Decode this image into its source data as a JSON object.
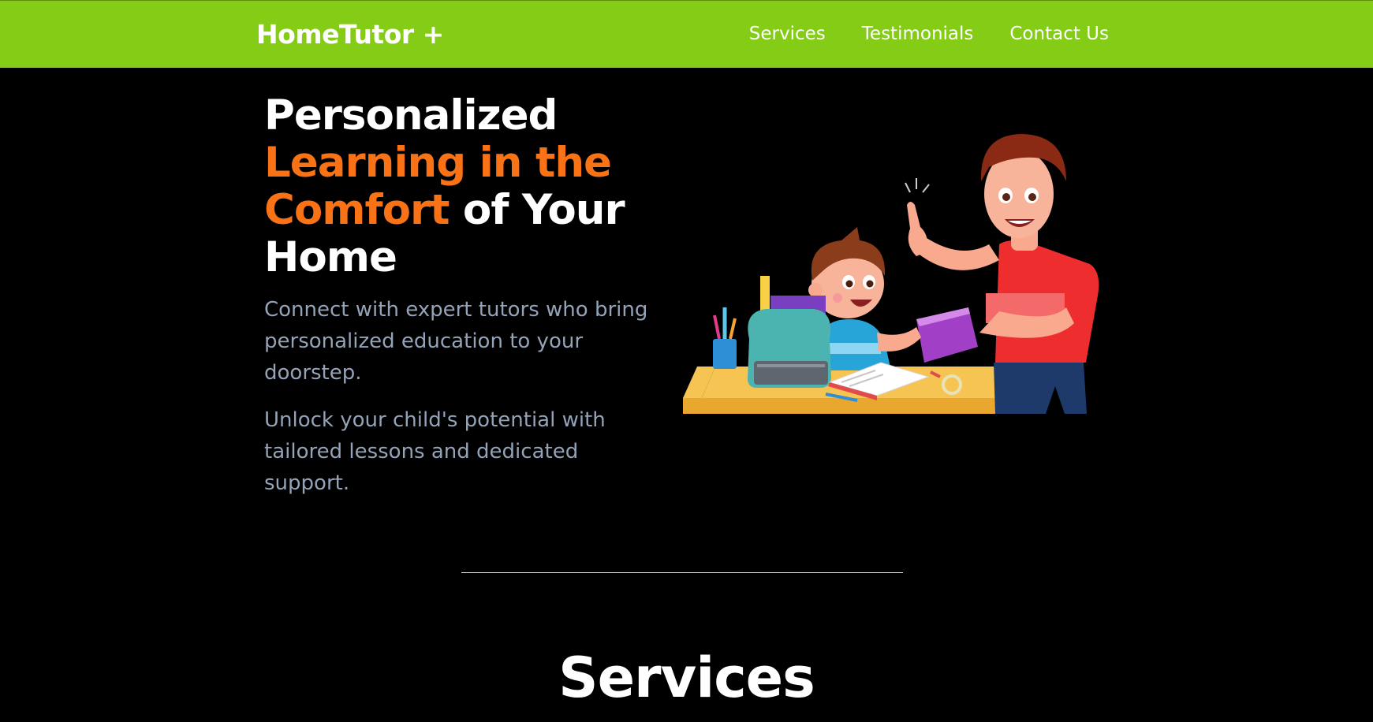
{
  "navbar": {
    "brand": "HomeTutor +",
    "links": [
      "Services",
      "Testimonials",
      "Contact Us"
    ]
  },
  "hero": {
    "title_parts": [
      "Personalized ",
      "Learning in the Comfort",
      " of Your Home"
    ],
    "paragraph_1": "Connect with expert tutors who bring personalized education to your doorstep.",
    "paragraph_2": "Unlock your child's potential with tailored lessons and dedicated support.",
    "illustration": "tutor-teaching-child-illustration"
  },
  "services": {
    "title": "Services"
  },
  "colors": {
    "nav_background": "#84cc16",
    "accent": "#f97316",
    "page_background": "#000000",
    "body_text": "#94a3b8"
  }
}
